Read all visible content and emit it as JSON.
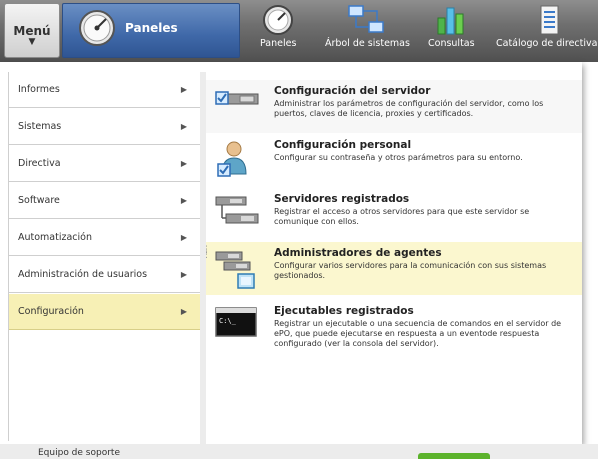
{
  "menu_button": {
    "label": "Menú",
    "arrow": "▼"
  },
  "current": {
    "label": "Paneles",
    "icon": "gauge-icon"
  },
  "nav": [
    {
      "label": "Paneles",
      "icon": "gauge-icon"
    },
    {
      "label": "Árbol de sistemas",
      "icon": "system-tree-icon"
    },
    {
      "label": "Consultas",
      "icon": "bar-chart-icon"
    },
    {
      "label": "Catálogo de directivas",
      "icon": "policy-catalog-icon"
    }
  ],
  "categories": [
    {
      "label": "Informes",
      "chevron": "▶"
    },
    {
      "label": "Sistemas",
      "chevron": "▶"
    },
    {
      "label": "Directiva",
      "chevron": "▶"
    },
    {
      "label": "Software",
      "chevron": "▶"
    },
    {
      "label": "Automatización",
      "chevron": "▶"
    },
    {
      "label": "Administración de usuarios",
      "chevron": "▶"
    },
    {
      "label": "Configuración",
      "chevron": "▶",
      "selected": true
    }
  ],
  "entries": [
    {
      "title": "Configuración del servidor",
      "description": "Administrar los parámetros de configuración del servidor, como los puertos, claves de licencia, proxies y certificados.",
      "icon": "server-settings-icon"
    },
    {
      "title": "Configuración personal",
      "description": "Configurar su contraseña y otros parámetros para su entorno.",
      "icon": "personal-settings-icon"
    },
    {
      "title": "Servidores registrados",
      "description": "Registrar el acceso a otros servidores para que este servidor se comunique con ellos.",
      "icon": "registered-servers-icon"
    },
    {
      "title": "Administradores de agentes",
      "description": "Configurar varios servidores para la comunicación con sus sistemas gestionados.",
      "icon": "agent-handlers-icon"
    },
    {
      "title": "Ejecutables registrados",
      "description": "Registrar un ejecutable o una secuencia de comandos en el servidor de ePO, que puede ejecutarse en respuesta a un eventode respuesta configurado (ver la consola del servidor).",
      "icon": "registered-executables-icon"
    }
  ],
  "footer": {
    "text": "Equipo de soporte"
  }
}
